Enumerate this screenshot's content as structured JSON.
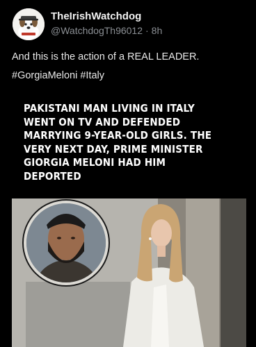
{
  "post": {
    "display_name": "TheIrishWatchdog",
    "handle": "@WatchdogTh96012",
    "separator": "·",
    "time": "8h",
    "text_line1": "And this is the action of a REAL LEADER.",
    "hashtags": [
      "#GorgiaMeloni",
      "#Italy"
    ]
  },
  "media": {
    "headline_lines": [
      "PAKISTANI MAN LIVING IN ITALY",
      "WENT ON TV AND DEFENDED",
      "MARRYING 9-YEAR-OLD GIRLS. THE",
      "VERY NEXT DAY, PRIME MINISTER",
      "GIORGIA MELONI HAD HIM",
      "DEPORTED"
    ]
  },
  "icons": {
    "avatar": "dog-avatar-icon"
  },
  "colors": {
    "background": "#000000",
    "text": "#e7e9ea",
    "muted": "#8b8f94"
  }
}
